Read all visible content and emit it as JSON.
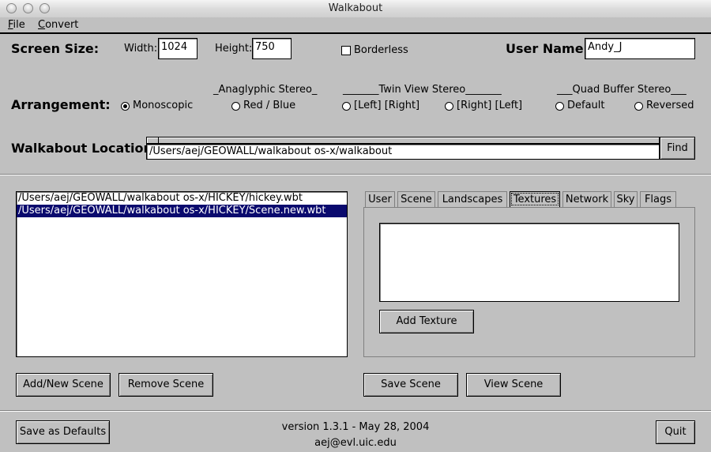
{
  "window": {
    "title": "Walkabout"
  },
  "menu": {
    "file": "File",
    "convert": "Convert"
  },
  "screen": {
    "label": "Screen Size:",
    "width_label": "Width:",
    "width_value": "1024",
    "height_label": "Height:",
    "height_value": "750",
    "borderless_label": "Borderless",
    "borderless_checked": false,
    "user_label": "User Name:",
    "user_value": "Andy_J"
  },
  "arrangement": {
    "label": "Arrangement:",
    "anaglyph_heading": "_Anaglyphic Stereo_",
    "twinview_heading": "_______Twin View Stereo_______",
    "quad_heading": "___Quad Buffer Stereo___",
    "options": [
      "Monoscopic",
      "Red / Blue",
      "[Left] [Right]",
      "[Right] [Left]",
      "Default",
      "Reversed"
    ],
    "selected": "Monoscopic"
  },
  "location": {
    "label": "Walkabout Location:",
    "value": "/Users/aej/GEOWALL/walkabout os-x/walkabout",
    "find_label": "Find"
  },
  "scenes": {
    "items": [
      "/Users/aej/GEOWALL/walkabout os-x/HICKEY/hickey.wbt",
      "/Users/aej/GEOWALL/walkabout os-x/HICKEY/Scene.new.wbt"
    ],
    "selected_index": 1,
    "add_label": "Add/New Scene",
    "remove_label": "Remove Scene"
  },
  "tabs": {
    "items": [
      "User",
      "Scene",
      "Landscapes",
      "Textures",
      "Network",
      "Sky",
      "Flags"
    ],
    "active": "Textures"
  },
  "textures": {
    "add_label": "Add Texture"
  },
  "scene_actions": {
    "save_label": "Save Scene",
    "view_label": "View Scene"
  },
  "footer": {
    "save_defaults_label": "Save as Defaults",
    "version": "version 1.3.1 - May 28, 2004",
    "email": "aej@evl.uic.edu",
    "quit_label": "Quit"
  }
}
